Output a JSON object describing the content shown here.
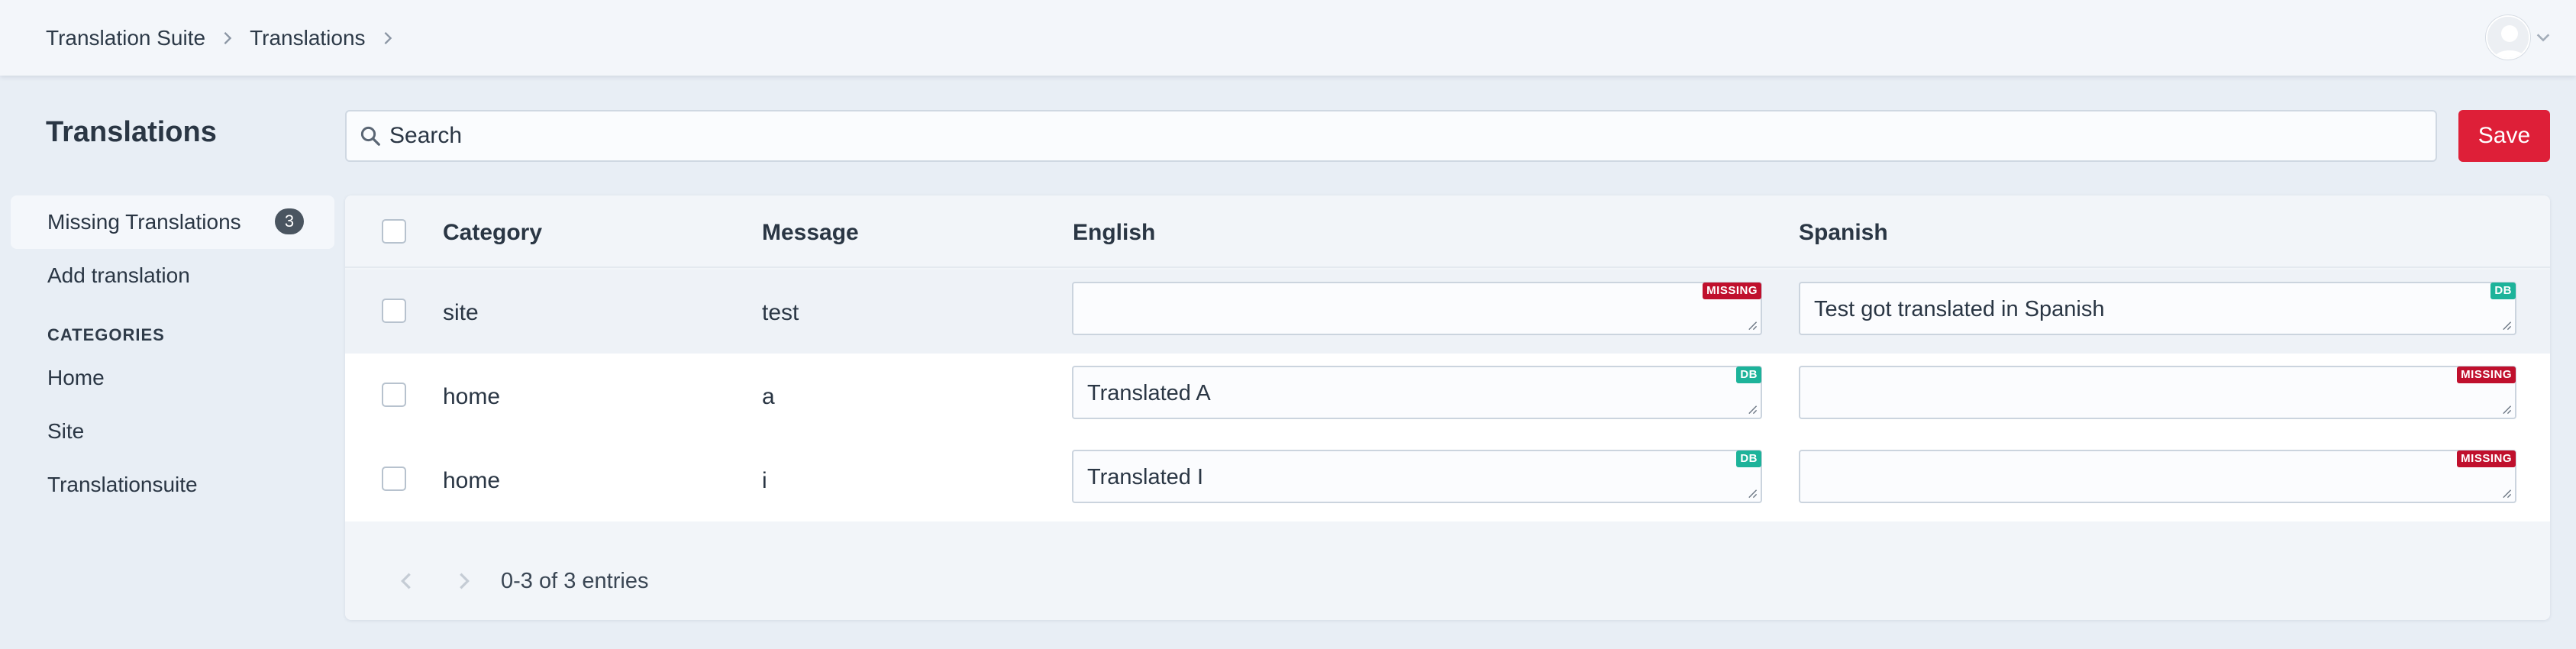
{
  "header": {
    "breadcrumbs": [
      "Translation Suite",
      "Translations"
    ]
  },
  "sidebar": {
    "title": "Translations",
    "items": [
      {
        "label": "Missing Translations",
        "count": "3"
      },
      {
        "label": "Add translation"
      }
    ],
    "categories_heading": "CATEGORIES",
    "categories": [
      "Home",
      "Site",
      "Translationsuite"
    ]
  },
  "search": {
    "placeholder": "Search",
    "value": ""
  },
  "toolbar": {
    "save_label": "Save"
  },
  "table": {
    "columns": [
      "Category",
      "Message",
      "English",
      "Spanish"
    ],
    "rows": [
      {
        "category": "site",
        "message": "test",
        "english": {
          "value": "",
          "status": "MISSING"
        },
        "spanish": {
          "value": "Test got translated in Spanish",
          "status": "DB"
        }
      },
      {
        "category": "home",
        "message": "a",
        "english": {
          "value": "Translated A",
          "status": "DB"
        },
        "spanish": {
          "value": "",
          "status": "MISSING"
        }
      },
      {
        "category": "home",
        "message": "i",
        "english": {
          "value": "Translated I",
          "status": "DB"
        },
        "spanish": {
          "value": "",
          "status": "MISSING"
        }
      }
    ]
  },
  "pagination": {
    "info": "0-3 of 3 entries"
  },
  "colors": {
    "accent": "#de1f38",
    "missing": "#c0102d",
    "db": "#1db39a"
  }
}
